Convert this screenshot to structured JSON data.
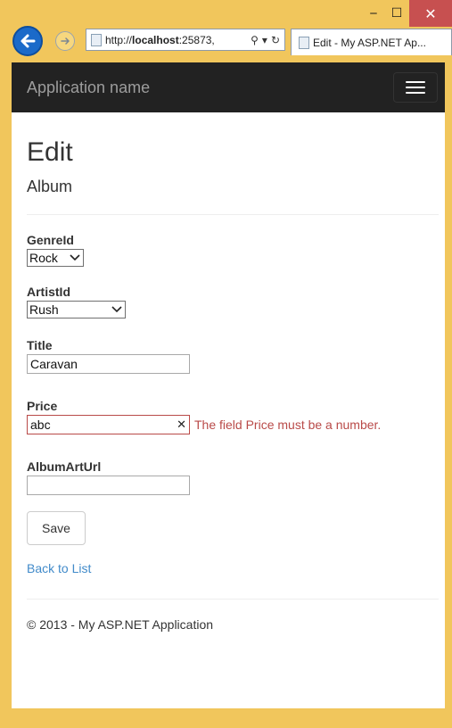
{
  "window": {
    "minimize_glyph": "‒",
    "maximize_glyph": "☐",
    "close_glyph": "✕",
    "frame_color": "#f1c65c",
    "close_color": "#c75050"
  },
  "browser": {
    "address_host": "http://",
    "address_bold": "localhost",
    "address_rest": ":25873,",
    "search_glyph": "⚲",
    "dropdown_glyph": "▾",
    "refresh_glyph": "↻",
    "tab_title": "Edit - My ASP.NET Ap..."
  },
  "navbar": {
    "brand": "Application name",
    "background": "#222222"
  },
  "page": {
    "heading": "Edit",
    "subheading": "Album"
  },
  "form": {
    "genre": {
      "label": "GenreId",
      "selected": "Rock"
    },
    "artist": {
      "label": "ArtistId",
      "selected": "Rush"
    },
    "title": {
      "label": "Title",
      "value": "Caravan"
    },
    "price": {
      "label": "Price",
      "value": "abc",
      "error": "The field Price must be a number."
    },
    "albumart": {
      "label": "AlbumArtUrl",
      "value": ""
    },
    "save_label": "Save"
  },
  "links": {
    "back": "Back to List"
  },
  "footer": {
    "text": "© 2013 - My ASP.NET Application"
  },
  "colors": {
    "error": "#b94a48",
    "link": "#428bca"
  }
}
